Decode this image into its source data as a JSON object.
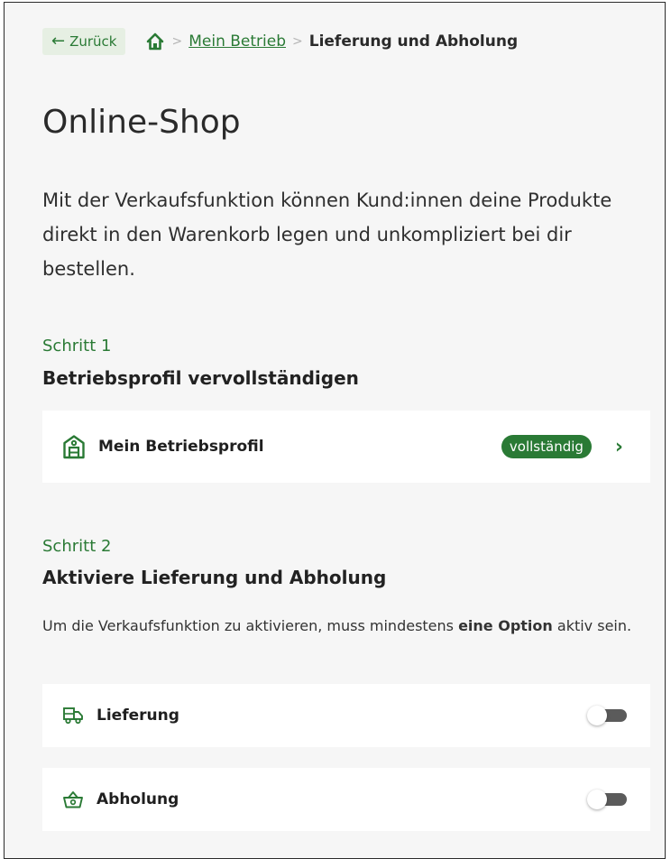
{
  "breadcrumb": {
    "back_label": "Zurück",
    "items": [
      "Mein Betrieb",
      "Lieferung und Abholung"
    ]
  },
  "page": {
    "title": "Online-Shop",
    "intro": "Mit der Verkaufsfunktion können Kund:innen deine Produkte direkt in den Warenkorb legen und unkompliziert bei dir bestellen."
  },
  "step1": {
    "label": "Schritt 1",
    "title": "Betriebsprofil vervollständigen",
    "card": {
      "label": "Mein Betriebsprofil",
      "badge": "vollständig"
    }
  },
  "step2": {
    "label": "Schritt 2",
    "title": "Aktiviere Lieferung und Abholung",
    "hint_prefix": "Um die Verkaufsfunktion zu aktivieren, muss mindestens ",
    "hint_bold": "eine Option",
    "hint_suffix": " aktiv sein.",
    "options": [
      {
        "label": "Lieferung",
        "icon": "delivery-truck-icon",
        "enabled": false
      },
      {
        "label": "Abholung",
        "icon": "shopping-basket-icon",
        "enabled": false
      }
    ]
  },
  "colors": {
    "accent": "#2a7a35",
    "background": "#f6f6f6",
    "card": "#ffffff",
    "toggle_off": "#5b5b5b"
  }
}
